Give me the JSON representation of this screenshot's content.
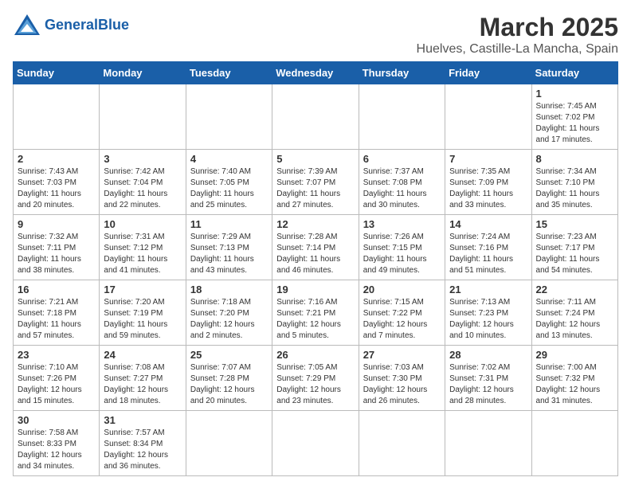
{
  "header": {
    "logo_text_normal": "General",
    "logo_text_bold": "Blue",
    "title": "March 2025",
    "subtitle": "Huelves, Castille-La Mancha, Spain"
  },
  "calendar": {
    "days_of_week": [
      "Sunday",
      "Monday",
      "Tuesday",
      "Wednesday",
      "Thursday",
      "Friday",
      "Saturday"
    ],
    "weeks": [
      [
        {
          "date": "",
          "info": ""
        },
        {
          "date": "",
          "info": ""
        },
        {
          "date": "",
          "info": ""
        },
        {
          "date": "",
          "info": ""
        },
        {
          "date": "",
          "info": ""
        },
        {
          "date": "",
          "info": ""
        },
        {
          "date": "1",
          "info": "Sunrise: 7:45 AM\nSunset: 7:02 PM\nDaylight: 11 hours and 17 minutes."
        }
      ],
      [
        {
          "date": "2",
          "info": "Sunrise: 7:43 AM\nSunset: 7:03 PM\nDaylight: 11 hours and 20 minutes."
        },
        {
          "date": "3",
          "info": "Sunrise: 7:42 AM\nSunset: 7:04 PM\nDaylight: 11 hours and 22 minutes."
        },
        {
          "date": "4",
          "info": "Sunrise: 7:40 AM\nSunset: 7:05 PM\nDaylight: 11 hours and 25 minutes."
        },
        {
          "date": "5",
          "info": "Sunrise: 7:39 AM\nSunset: 7:07 PM\nDaylight: 11 hours and 27 minutes."
        },
        {
          "date": "6",
          "info": "Sunrise: 7:37 AM\nSunset: 7:08 PM\nDaylight: 11 hours and 30 minutes."
        },
        {
          "date": "7",
          "info": "Sunrise: 7:35 AM\nSunset: 7:09 PM\nDaylight: 11 hours and 33 minutes."
        },
        {
          "date": "8",
          "info": "Sunrise: 7:34 AM\nSunset: 7:10 PM\nDaylight: 11 hours and 35 minutes."
        }
      ],
      [
        {
          "date": "9",
          "info": "Sunrise: 7:32 AM\nSunset: 7:11 PM\nDaylight: 11 hours and 38 minutes."
        },
        {
          "date": "10",
          "info": "Sunrise: 7:31 AM\nSunset: 7:12 PM\nDaylight: 11 hours and 41 minutes."
        },
        {
          "date": "11",
          "info": "Sunrise: 7:29 AM\nSunset: 7:13 PM\nDaylight: 11 hours and 43 minutes."
        },
        {
          "date": "12",
          "info": "Sunrise: 7:28 AM\nSunset: 7:14 PM\nDaylight: 11 hours and 46 minutes."
        },
        {
          "date": "13",
          "info": "Sunrise: 7:26 AM\nSunset: 7:15 PM\nDaylight: 11 hours and 49 minutes."
        },
        {
          "date": "14",
          "info": "Sunrise: 7:24 AM\nSunset: 7:16 PM\nDaylight: 11 hours and 51 minutes."
        },
        {
          "date": "15",
          "info": "Sunrise: 7:23 AM\nSunset: 7:17 PM\nDaylight: 11 hours and 54 minutes."
        }
      ],
      [
        {
          "date": "16",
          "info": "Sunrise: 7:21 AM\nSunset: 7:18 PM\nDaylight: 11 hours and 57 minutes."
        },
        {
          "date": "17",
          "info": "Sunrise: 7:20 AM\nSunset: 7:19 PM\nDaylight: 11 hours and 59 minutes."
        },
        {
          "date": "18",
          "info": "Sunrise: 7:18 AM\nSunset: 7:20 PM\nDaylight: 12 hours and 2 minutes."
        },
        {
          "date": "19",
          "info": "Sunrise: 7:16 AM\nSunset: 7:21 PM\nDaylight: 12 hours and 5 minutes."
        },
        {
          "date": "20",
          "info": "Sunrise: 7:15 AM\nSunset: 7:22 PM\nDaylight: 12 hours and 7 minutes."
        },
        {
          "date": "21",
          "info": "Sunrise: 7:13 AM\nSunset: 7:23 PM\nDaylight: 12 hours and 10 minutes."
        },
        {
          "date": "22",
          "info": "Sunrise: 7:11 AM\nSunset: 7:24 PM\nDaylight: 12 hours and 13 minutes."
        }
      ],
      [
        {
          "date": "23",
          "info": "Sunrise: 7:10 AM\nSunset: 7:26 PM\nDaylight: 12 hours and 15 minutes."
        },
        {
          "date": "24",
          "info": "Sunrise: 7:08 AM\nSunset: 7:27 PM\nDaylight: 12 hours and 18 minutes."
        },
        {
          "date": "25",
          "info": "Sunrise: 7:07 AM\nSunset: 7:28 PM\nDaylight: 12 hours and 20 minutes."
        },
        {
          "date": "26",
          "info": "Sunrise: 7:05 AM\nSunset: 7:29 PM\nDaylight: 12 hours and 23 minutes."
        },
        {
          "date": "27",
          "info": "Sunrise: 7:03 AM\nSunset: 7:30 PM\nDaylight: 12 hours and 26 minutes."
        },
        {
          "date": "28",
          "info": "Sunrise: 7:02 AM\nSunset: 7:31 PM\nDaylight: 12 hours and 28 minutes."
        },
        {
          "date": "29",
          "info": "Sunrise: 7:00 AM\nSunset: 7:32 PM\nDaylight: 12 hours and 31 minutes."
        }
      ],
      [
        {
          "date": "30",
          "info": "Sunrise: 7:58 AM\nSunset: 8:33 PM\nDaylight: 12 hours and 34 minutes."
        },
        {
          "date": "31",
          "info": "Sunrise: 7:57 AM\nSunset: 8:34 PM\nDaylight: 12 hours and 36 minutes."
        },
        {
          "date": "",
          "info": ""
        },
        {
          "date": "",
          "info": ""
        },
        {
          "date": "",
          "info": ""
        },
        {
          "date": "",
          "info": ""
        },
        {
          "date": "",
          "info": ""
        }
      ]
    ]
  }
}
